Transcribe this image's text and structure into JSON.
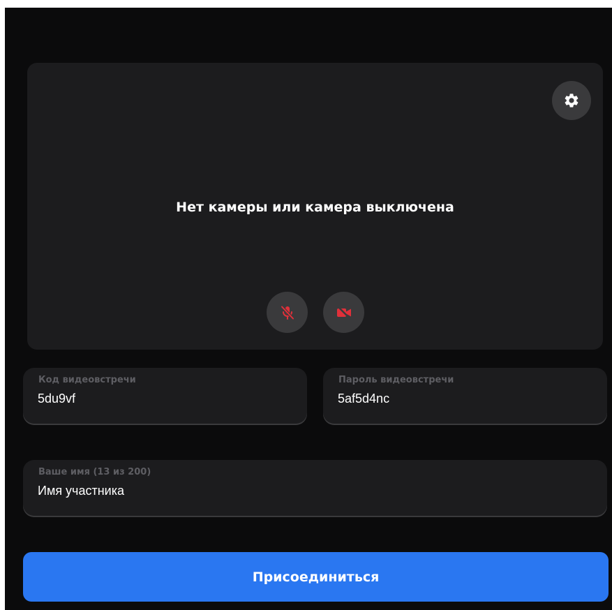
{
  "preview": {
    "status_text": "Нет камеры или камера выключена",
    "settings_icon": "gear-icon",
    "mic_icon": "microphone-off-icon",
    "camera_icon": "camera-off-icon",
    "muted_color": "#e0303a"
  },
  "form": {
    "code": {
      "label": "Код видеовстречи",
      "value": "5du9vf"
    },
    "password": {
      "label": "Пароль видеовстречи",
      "value": "5af5d4nc"
    },
    "name": {
      "label": "Ваше имя (13 из 200)",
      "value": "Имя участника"
    }
  },
  "join_button": {
    "label": "Присоединиться",
    "color": "#2a77f1"
  }
}
